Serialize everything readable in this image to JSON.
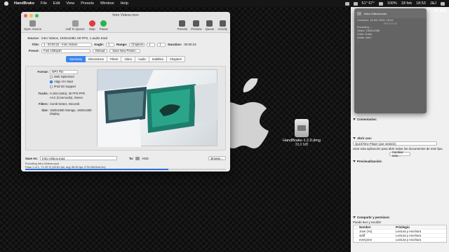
{
  "menubar": {
    "app": "HandBrake",
    "items": [
      "File",
      "Edit",
      "View",
      "Presets",
      "Window",
      "Help"
    ],
    "status": [
      "51° 67°",
      "100%",
      "18 feb",
      "18:53",
      "J&J"
    ]
  },
  "desktop_file": {
    "name": "HandBrake-1.2.0.dmg",
    "size": "20,6 MB"
  },
  "handbrake": {
    "title": "Intro Videos.mov",
    "toolbar_left": [
      {
        "label": "Open Source",
        "color": "#7a7a7a"
      },
      {
        "label": "Add To Queue",
        "color": "#8a8a8a"
      },
      {
        "label": "Stop",
        "color": "#e23b3b"
      },
      {
        "label": "Pause",
        "color": "#29b34a"
      }
    ],
    "toolbar_right": [
      {
        "label": "Presets",
        "color": "#666"
      },
      {
        "label": "Preview",
        "color": "#666"
      },
      {
        "label": "Queue",
        "color": "#666"
      },
      {
        "label": "Activity",
        "color": "#666"
      }
    ],
    "source_label": "Source:",
    "source_value": "Intro Videos, 1920x1080, 60 FPS, 1 audio track",
    "title_label": "Title:",
    "title_value": "1 - 00:00:22 - Intro Videos",
    "angle_label": "Angle:",
    "angle_value": "1",
    "range_label": "Range:",
    "range_value": "Chapters",
    "range_from": "1",
    "range_to": "1",
    "duration_label": "Duration:",
    "duration_value": "00:00:22",
    "preset_label": "Preset:",
    "preset_value": "Fast 1080p30",
    "reload_button": "Reload",
    "save_preset_button": "Save New Preset...",
    "tabs": [
      "Summary",
      "Dimensions",
      "Filters",
      "Video",
      "Audio",
      "Subtitles",
      "Chapters"
    ],
    "active_tab": "Summary",
    "format_label": "Format:",
    "format_value": "MP4 File",
    "checks": [
      {
        "label": "Web Optimized",
        "on": false
      },
      {
        "label": "Align A/V Start",
        "on": true
      },
      {
        "label": "iPod 5G Support",
        "on": false
      }
    ],
    "info": [
      {
        "k": "Tracks:",
        "v": "H.264 (x264), 30 FPS PFR"
      },
      {
        "k": "",
        "v": "AAC (CoreAudio), Stereo"
      },
      {
        "k": "Filters:",
        "v": "Comb Detect, Decomb"
      },
      {
        "k": "Size:",
        "v": "1920x1080 Storage, 1920x1080 Display"
      }
    ],
    "save_as_label": "Save As:",
    "save_as_value": "Intro Videos.mp4",
    "to_label": "To:",
    "to_value": "HDD",
    "browse_button": "Browse...",
    "status_line1": "Encoding Intro Videos.mp4",
    "status_line2": "Pass 1 of 1, 71.20 % (30.81 fps, avg 38.35 fps, ETA 00h00m11s)",
    "progress": 0.712
  },
  "activity": {
    "title": "Intro Videos.mov",
    "lines": [
      "Creación: 18 feb 2019, 18:44",
      "PROCESS",
      "Encoding: ...",
      "Video: 1920x1080",
      "Color: 8 bits",
      "Audio: AAC",
      "..."
    ]
  },
  "info_panel": {
    "size": "76 MB",
    "comments": "Comentarios:",
    "open_with": "Abrir con:",
    "open_with_value": "QuickTime Player (por omisión)",
    "open_with_note": "Usar esta aplicación para abrir todos los documentos de este tipo.",
    "change_all": "Cambiar todo...",
    "preview": "Previsualización:",
    "sharing": "Compartir y permisos:",
    "sharing_note": "Puede leer y escribir",
    "perm_headers": [
      "Nombre",
      "Privilegio"
    ],
    "perms": [
      {
        "name": "Jose (Yo)",
        "priv": "Lectura y escritura"
      },
      {
        "name": "staff",
        "priv": "Lectura y escritura"
      },
      {
        "name": "everyone",
        "priv": "Lectura y escritura"
      }
    ]
  }
}
